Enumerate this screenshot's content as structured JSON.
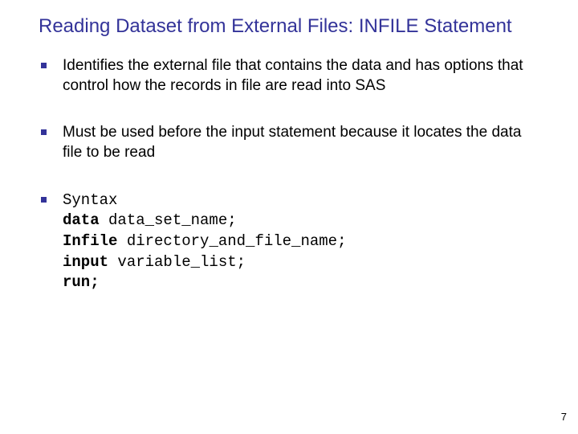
{
  "title": "Reading Dataset from External Files: INFILE Statement",
  "bullets": {
    "b1": "Identifies the external file that contains the data and has options that control how the records in file are read into SAS",
    "b2": "Must be used before the input statement because it locates the data file to be read",
    "b3_label": "Syntax",
    "syntax": {
      "kw_data": "data",
      "arg_data": " data_set_name;",
      "kw_infile": "Infile",
      "arg_infile": " directory_and_file_name;",
      "kw_input": "input",
      "arg_input": " variable_list;",
      "kw_run": "run;"
    }
  },
  "page_number": "7"
}
